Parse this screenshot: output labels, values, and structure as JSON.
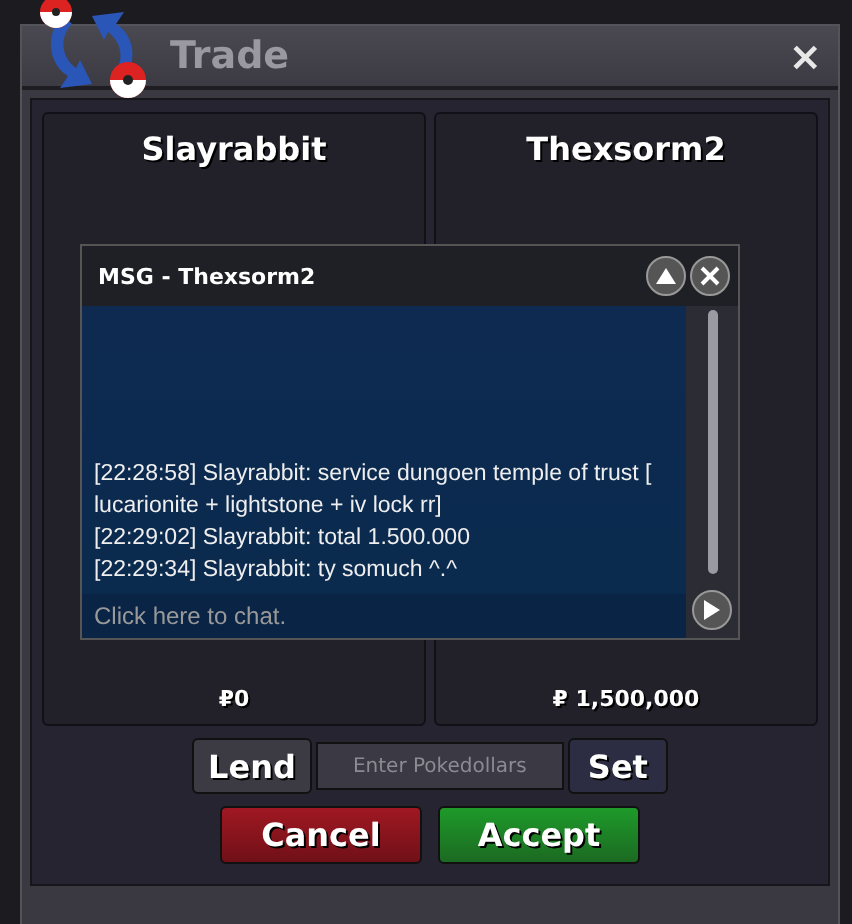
{
  "window": {
    "title": "Trade",
    "close": "×"
  },
  "panels": [
    {
      "name": "Slayrabbit",
      "amount": "₽0"
    },
    {
      "name": "Thexsorm2",
      "amount": "₽ 1,500,000"
    }
  ],
  "chat": {
    "title": "MSG - Thexsorm2",
    "messages": [
      "[22:28:58] Slayrabbit: service dungoen temple of trust [ lucarionite + lightstone + iv lock rr]",
      "[22:29:02] Slayrabbit: total 1.500.000",
      "[22:29:34] Slayrabbit: ty somuch ^.^"
    ],
    "placeholder": "Click here to chat."
  },
  "money": {
    "lend": "Lend",
    "placeholder": "Enter Pokedollars",
    "set": "Set"
  },
  "actions": [
    {
      "label": "Cancel",
      "kind": "cancel"
    },
    {
      "label": "Accept",
      "kind": "accept"
    }
  ]
}
